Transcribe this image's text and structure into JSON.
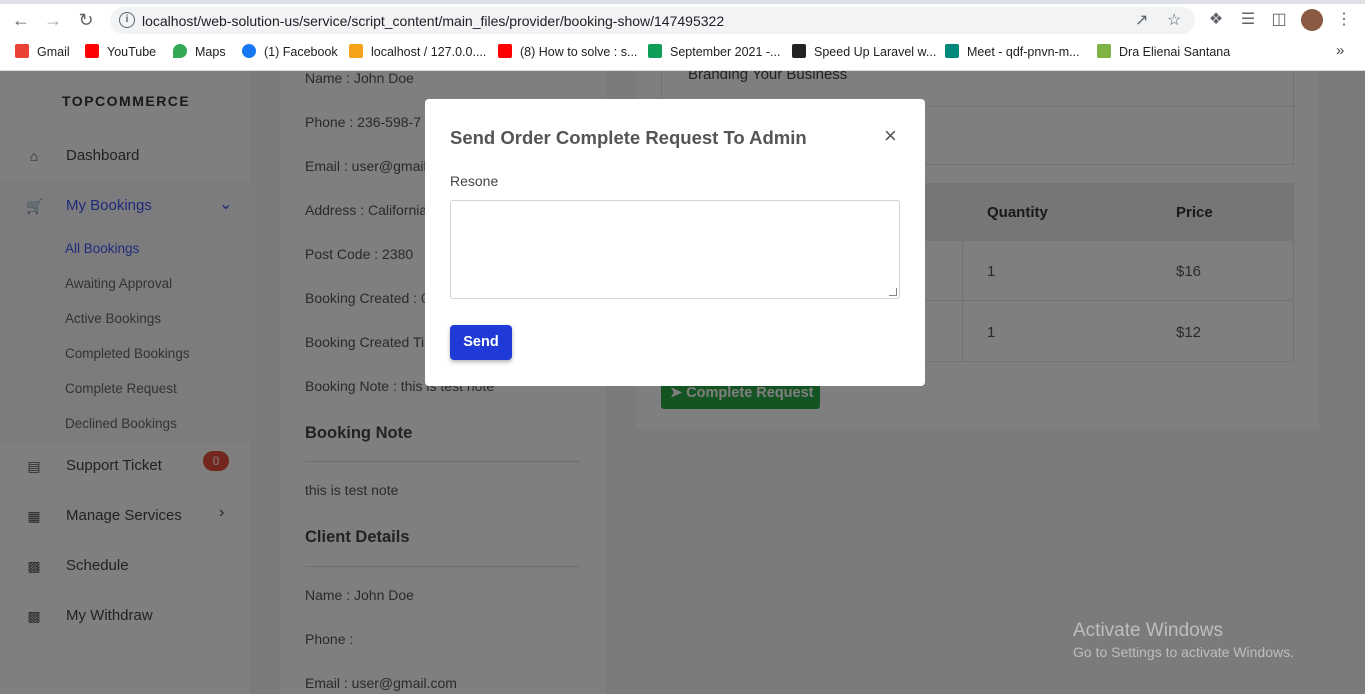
{
  "browser": {
    "url": "localhost/web-solution-us/service/script_content/main_files/provider/booking-show/147495322",
    "bookmarks": [
      {
        "label": "Gmail",
        "color": "#ea4335"
      },
      {
        "label": "YouTube",
        "color": "#ff0000"
      },
      {
        "label": "Maps",
        "color": "#34a853"
      },
      {
        "label": "(1) Facebook",
        "color": "#1877f2"
      },
      {
        "label": "localhost / 127.0.0....",
        "color": "#f7a21b"
      },
      {
        "label": "(8) How to solve : s...",
        "color": "#ff0000"
      },
      {
        "label": "September 2021 -...",
        "color": "#0f9d58"
      },
      {
        "label": "Speed Up Laravel w...",
        "color": "#222222"
      },
      {
        "label": "Meet - qdf-pnvn-m...",
        "color": "#00897b"
      },
      {
        "label": "Dra Elienai Santana",
        "color": "#7cb342"
      }
    ]
  },
  "sidebar": {
    "brand": "TOPCOMMERCE",
    "items": [
      {
        "label": "Dashboard",
        "icon": "home-icon"
      },
      {
        "label": "My Bookings",
        "icon": "cart-icon"
      },
      {
        "label": "Support Ticket",
        "icon": "ticket-icon",
        "badge": "0"
      },
      {
        "label": "Manage Services",
        "icon": "grid-icon"
      },
      {
        "label": "Schedule",
        "icon": "calendar-icon"
      },
      {
        "label": "My Withdraw",
        "icon": "wallet-icon"
      }
    ],
    "submenu": [
      "All Bookings",
      "Awaiting Approval",
      "Active Bookings",
      "Completed Bookings",
      "Complete Request",
      "Declined Bookings"
    ]
  },
  "details": {
    "name": "Name : John Doe",
    "phone": "Phone : 236-598-7",
    "email": "Email : user@gmail",
    "address": "Address : California",
    "post_code": "Post Code : 2380",
    "booking_created": "Booking Created : 0",
    "booking_created_time": "Booking Created Ti",
    "booking_note": "Booking Note : this is test note",
    "booking_note_heading": "Booking Note",
    "booking_note_text": "this is test note",
    "client_heading": "Client Details",
    "client_name": "Name : John Doe",
    "client_phone": "Phone :",
    "client_email": "Email : user@gmail.com"
  },
  "services": {
    "item_text": "Branding Your Business",
    "headers": {
      "quantity": "Quantity",
      "price": "Price"
    },
    "rows": [
      {
        "quantity": "1",
        "price": "$16"
      },
      {
        "quantity": "1",
        "price": "$12"
      }
    ],
    "complete_button": "Complete Request"
  },
  "modal": {
    "title": "Send Order Complete Request To Admin",
    "close": "×",
    "label": "Resone",
    "textarea_value": "",
    "send": "Send"
  },
  "watermark": {
    "title": "Activate Windows",
    "subtitle": "Go to Settings to activate Windows."
  }
}
